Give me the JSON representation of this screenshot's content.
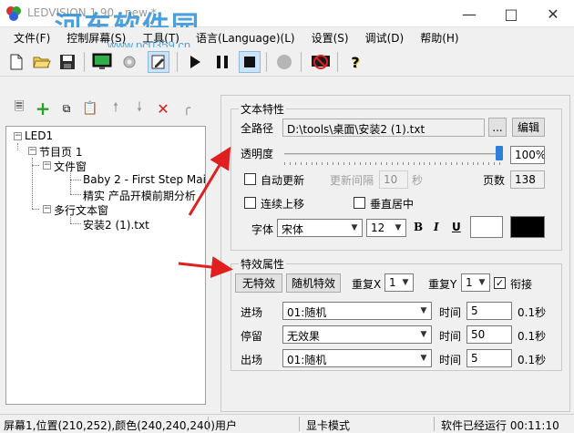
{
  "window": {
    "title": "LEDVISION 1.90 - new *",
    "watermark": "河东软件园",
    "watermark_url": "www.pc0359.cn"
  },
  "menu": [
    "文件(F)",
    "控制屏幕(S)",
    "工具(T)",
    "语言(Language)(L)",
    "设置(S)",
    "调试(D)",
    "帮助(H)"
  ],
  "tree": {
    "nodes": [
      {
        "label": "LED1"
      },
      {
        "label": "节目页 1"
      },
      {
        "label": "文件窗"
      },
      {
        "label": "Baby 2 - First Step Main"
      },
      {
        "label": "精实  产品开模前期分析"
      },
      {
        "label": "多行文本窗"
      },
      {
        "label": "安装2 (1).txt"
      }
    ]
  },
  "text_props": {
    "title": "文本特性",
    "path_label": "全路径",
    "path_value": "D:\\tools\\桌面\\安装2 (1).txt",
    "browse_label": "...",
    "edit_label": "编辑",
    "transparency_label": "透明度",
    "transparency_value": "100%",
    "transparency_level": 1.0,
    "auto_update_label": "自动更新",
    "update_interval_label": "更新间隔",
    "update_interval_value": "10",
    "seconds_label": "秒",
    "page_count_label": "页数",
    "page_count_value": "138",
    "scroll_up_label": "连续上移",
    "vertical_center_label": "垂直居中",
    "font_label": "字体",
    "font_value": "宋体",
    "font_size_value": "12",
    "bold_label": "B",
    "italic_label": "I",
    "underline_label": "U",
    "colors": {
      "background": "#ffffff",
      "text": "#000000"
    }
  },
  "effect_props": {
    "title": "特效属性",
    "no_effect_label": "无特效",
    "random_effect_label": "随机特效",
    "repeat_x_label": "重复X",
    "repeat_x_value": "1",
    "repeat_y_label": "重复Y",
    "repeat_y_value": "1",
    "connect_label": "衔接",
    "rows": [
      {
        "label": "进场",
        "effect": "01:随机",
        "time_label": "时间",
        "time": "5",
        "unit": "0.1秒"
      },
      {
        "label": "停留",
        "effect": "无效果",
        "time_label": "时间",
        "time": "50",
        "unit": "0.1秒"
      },
      {
        "label": "出场",
        "effect": "01:随机",
        "time_label": "时间",
        "time": "5",
        "unit": "0.1秒"
      }
    ]
  },
  "status": {
    "position": "屏幕1,位置(210,252),颜色(240,240,240)",
    "user": "用户",
    "mode": "显卡模式",
    "runtime": "软件已经运行 00:11:10"
  },
  "accent": "#e02020"
}
